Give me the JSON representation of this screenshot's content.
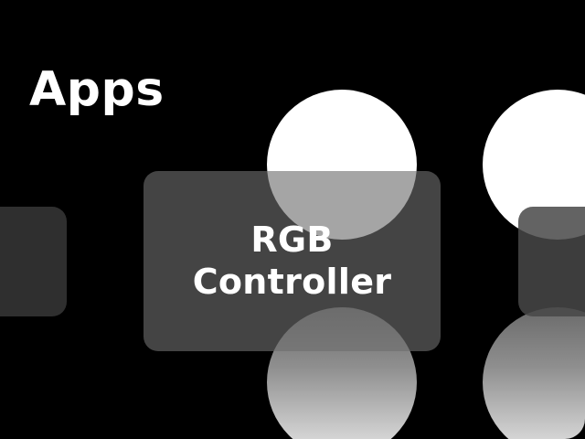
{
  "screen": {
    "title": "Apps"
  },
  "carousel": {
    "selected_app": {
      "label": "RGB\nController"
    }
  }
}
